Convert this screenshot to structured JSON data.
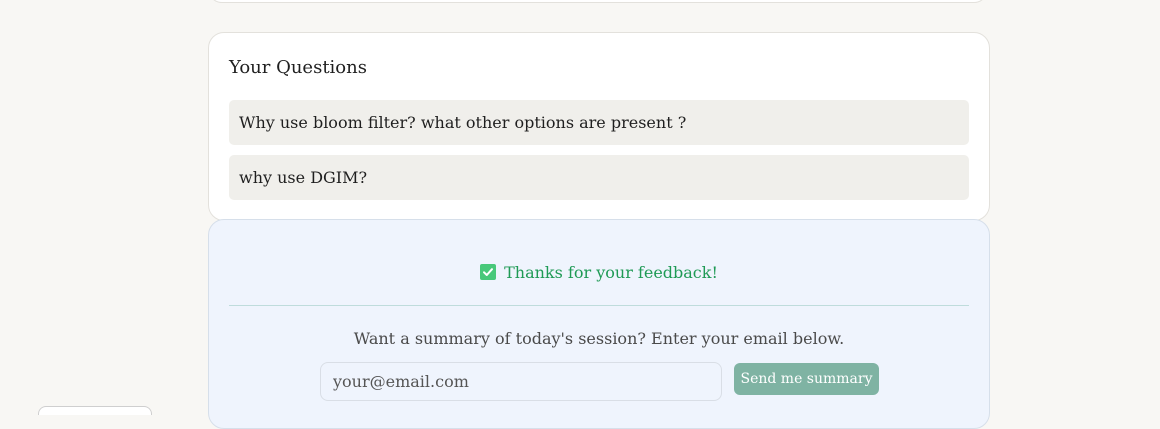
{
  "questions_section": {
    "title": "Your Questions",
    "items": [
      {
        "text": "Why use bloom filter? what other options are present ?"
      },
      {
        "text": "why use DGIM?"
      }
    ]
  },
  "feedback_section": {
    "icon": "check-mark-icon",
    "thanks_text": "Thanks for your feedback!",
    "summary_prompt": "Want a summary of today's session? Enter your email below.",
    "email_placeholder": "your@email.com",
    "email_value": "",
    "send_button_label": "Send me summary"
  },
  "colors": {
    "page_background": "#f8f7f4",
    "card_background": "#ffffff",
    "question_background": "#f0efeb",
    "feedback_background": "#eff4fd",
    "success_text": "#1f9a55",
    "check_icon": "#48c87a",
    "button_background": "#7fb3a3"
  }
}
